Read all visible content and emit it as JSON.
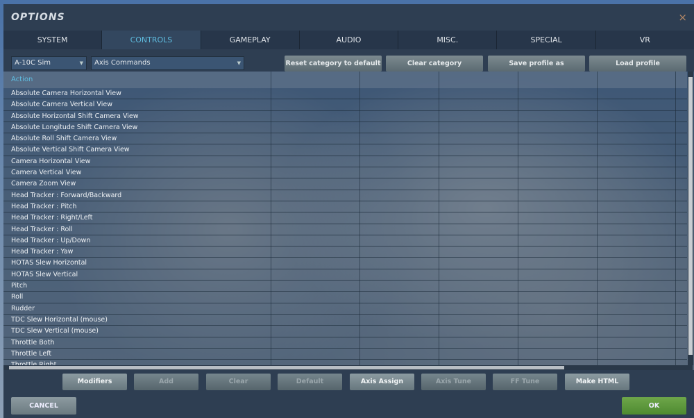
{
  "window": {
    "title": "OPTIONS",
    "close_icon": "×"
  },
  "tabs": [
    {
      "label": "SYSTEM"
    },
    {
      "label": "CONTROLS",
      "active": true
    },
    {
      "label": "GAMEPLAY"
    },
    {
      "label": "AUDIO"
    },
    {
      "label": "MISC."
    },
    {
      "label": "SPECIAL"
    },
    {
      "label": "VR"
    }
  ],
  "toolbar": {
    "aircraft": "A-10C Sim",
    "category": "Axis Commands",
    "reset": "Reset category to default",
    "clear": "Clear category",
    "save": "Save profile as",
    "load": "Load profile"
  },
  "table": {
    "header": "Action",
    "rows": [
      "Absolute Camera Horizontal View",
      "Absolute Camera Vertical View",
      "Absolute Horizontal Shift Camera View",
      "Absolute Longitude Shift Camera View",
      "Absolute Roll Shift Camera View",
      "Absolute Vertical Shift Camera View",
      "Camera Horizontal View",
      "Camera Vertical View",
      "Camera Zoom View",
      "Head Tracker : Forward/Backward",
      "Head Tracker : Pitch",
      "Head Tracker : Right/Left",
      "Head Tracker : Roll",
      "Head Tracker : Up/Down",
      "Head Tracker : Yaw",
      "HOTAS Slew Horizontal",
      "HOTAS Slew Vertical",
      "Pitch",
      "Roll",
      "Rudder",
      "TDC Slew Horizontal (mouse)",
      "TDC Slew Vertical (mouse)",
      "Throttle Both",
      "Throttle Left",
      "Throttle Right"
    ]
  },
  "actions": {
    "modifiers": "Modifiers",
    "add": "Add",
    "clear": "Clear",
    "default": "Default",
    "axis_assign": "Axis Assign",
    "axis_tune": "Axis Tune",
    "ff_tune": "FF Tune",
    "make_html": "Make HTML"
  },
  "footer": {
    "cancel": "CANCEL",
    "ok": "OK"
  },
  "colors": {
    "accent": "#5fbde0",
    "ok": "#5a9a3a"
  }
}
